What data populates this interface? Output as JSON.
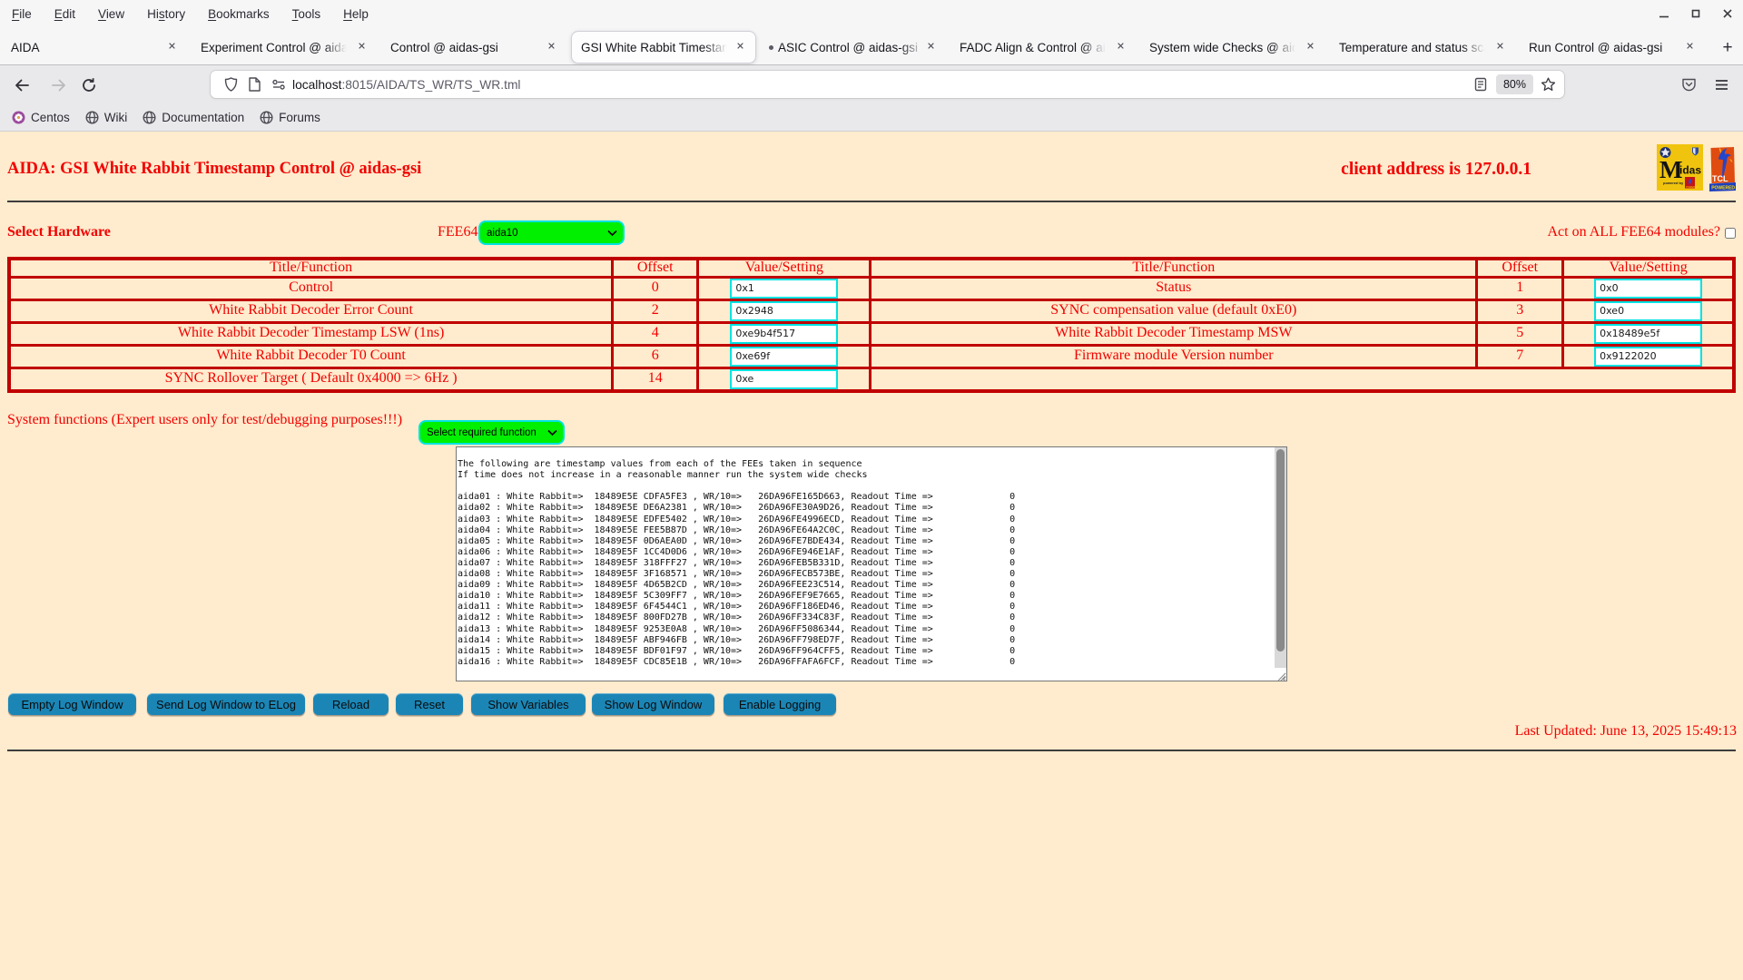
{
  "browser": {
    "menu": [
      {
        "pre": "",
        "u": "F",
        "post": "ile"
      },
      {
        "pre": "",
        "u": "E",
        "post": "dit"
      },
      {
        "pre": "",
        "u": "V",
        "post": "iew"
      },
      {
        "pre": "Hi",
        "u": "s",
        "post": "tory"
      },
      {
        "pre": "",
        "u": "B",
        "post": "ookmarks"
      },
      {
        "pre": "",
        "u": "T",
        "post": "ools"
      },
      {
        "pre": "",
        "u": "H",
        "post": "elp"
      }
    ],
    "window_controls": {
      "minimize": "minimize",
      "restore": "restore",
      "close": "close"
    },
    "tabs": [
      {
        "title": "AIDA"
      },
      {
        "title": "Experiment Control @ aidas-gsi"
      },
      {
        "title": "Control @ aidas-gsi"
      },
      {
        "title": "GSI White Rabbit Timestamp Control @ aidas-gsi",
        "active": true
      },
      {
        "title": "ASIC Control @ aidas-gsi",
        "attention_dot": true
      },
      {
        "title": "FADC Align & Control @ aidas-gsi"
      },
      {
        "title": "System wide Checks @ aidas-gsi"
      },
      {
        "title": "Temperature and status scans @ aidas-gsi"
      },
      {
        "title": "Run Control @ aidas-gsi"
      }
    ],
    "tab_close_glyph": "✕",
    "new_tab_label": "+",
    "url": {
      "host": "localhost",
      "path": ":8015/AIDA/TS_WR/TS_WR.tml"
    },
    "zoom_level": "80%",
    "bookmarks": [
      {
        "label": "Centos",
        "icon": "centos-icon"
      },
      {
        "label": "Wiki",
        "icon": "globe-icon"
      },
      {
        "label": "Documentation",
        "icon": "globe-icon"
      },
      {
        "label": "Forums",
        "icon": "globe-icon"
      }
    ]
  },
  "page": {
    "title": "AIDA: GSI White Rabbit Timestamp Control @ aidas-gsi",
    "client_address": "client address is 127.0.0.1",
    "logos": {
      "midas": "Midas logo",
      "tcl": "TCL powered logo"
    },
    "select_hardware_label": "Select Hardware",
    "fee64_label": "FEE64",
    "fee64_selected": "aida10",
    "act_on_all_label": "Act on ALL FEE64 modules?",
    "table": {
      "headers": {
        "title": "Title/Function",
        "offset": "Offset",
        "value": "Value/Setting"
      },
      "left_rows": [
        {
          "title": "Control",
          "offset": "0",
          "value": "0x1"
        },
        {
          "title": "White Rabbit Decoder Error Count",
          "offset": "2",
          "value": "0x2948"
        },
        {
          "title": "White Rabbit Decoder Timestamp LSW (1ns)",
          "offset": "4",
          "value": "0xe9b4f517"
        },
        {
          "title": "White Rabbit Decoder T0 Count",
          "offset": "6",
          "value": "0xe69f"
        },
        {
          "title": "SYNC Rollover Target ( Default 0x4000 => 6Hz )",
          "offset": "14",
          "value": "0xe"
        }
      ],
      "right_rows": [
        {
          "title": "Status",
          "offset": "1",
          "value": "0x0"
        },
        {
          "title": "SYNC compensation value (default 0xE0)",
          "offset": "3",
          "value": "0xe0"
        },
        {
          "title": "White Rabbit Decoder Timestamp MSW",
          "offset": "5",
          "value": "0x18489e5f"
        },
        {
          "title": "Firmware module Version number",
          "offset": "7",
          "value": "0x9122020"
        }
      ]
    },
    "system_functions_label": "System functions (Expert users only for test/debugging purposes!!!)",
    "system_functions_selected": "Select required function",
    "log": {
      "lines": [
        "",
        "The following are timestamp values from each of the FEEs taken in sequence",
        "If time does not increase in a reasonable manner run the system wide checks",
        "",
        "aida01 : White Rabbit=>  18489E5E CDFA5FE3 , WR/10=>   26DA96FE165D663, Readout Time =>              0",
        "aida02 : White Rabbit=>  18489E5E DE6A2381 , WR/10=>   26DA96FE30A9D26, Readout Time =>              0",
        "aida03 : White Rabbit=>  18489E5E EDFE5402 , WR/10=>   26DA96FE4996ECD, Readout Time =>              0",
        "aida04 : White Rabbit=>  18489E5E FEE5B87D , WR/10=>   26DA96FE64A2C0C, Readout Time =>              0",
        "aida05 : White Rabbit=>  18489E5F 0D6AEA0D , WR/10=>   26DA96FE7BDE434, Readout Time =>              0",
        "aida06 : White Rabbit=>  18489E5F 1CC4D0D6 , WR/10=>   26DA96FE946E1AF, Readout Time =>              0",
        "aida07 : White Rabbit=>  18489E5F 318FFF27 , WR/10=>   26DA96FEB5B331D, Readout Time =>              0",
        "aida08 : White Rabbit=>  18489E5F 3F168571 , WR/10=>   26DA96FECB573BE, Readout Time =>              0",
        "aida09 : White Rabbit=>  18489E5F 4D65B2CD , WR/10=>   26DA96FEE23C514, Readout Time =>              0",
        "aida10 : White Rabbit=>  18489E5F 5C309FF7 , WR/10=>   26DA96FEF9E7665, Readout Time =>              0",
        "aida11 : White Rabbit=>  18489E5F 6F4544C1 , WR/10=>   26DA96FF186ED46, Readout Time =>              0",
        "aida12 : White Rabbit=>  18489E5F 800FD27B , WR/10=>   26DA96FF334C83F, Readout Time =>              0",
        "aida13 : White Rabbit=>  18489E5F 9253E0A8 , WR/10=>   26DA96FF5086344, Readout Time =>              0",
        "aida14 : White Rabbit=>  18489E5F ABF946FB , WR/10=>   26DA96FF798ED7F, Readout Time =>              0",
        "aida15 : White Rabbit=>  18489E5F BDF01F97 , WR/10=>   26DA96FF964CFF5, Readout Time =>              0",
        "aida16 : White Rabbit=>  18489E5F CDC85E1B , WR/10=>   26DA96FFAFA6FCF, Readout Time =>              0",
        "",
        "",
        ""
      ]
    },
    "buttons": [
      "Empty Log Window",
      "Send Log Window to ELog",
      "Reload",
      "Reset",
      "Show Variables",
      "Show Log Window",
      "Enable Logging"
    ],
    "last_updated": "Last Updated: June 13, 2025 15:49:13"
  },
  "colors": {
    "page_background": "#ffebcd",
    "page_text_red": "#f20000",
    "table_border_red": "#c00000",
    "input_border_cyan": "#00e2e2",
    "select_green": "#00f000",
    "button_blue": "#1b86b6",
    "chrome_top": "#f6f6f7",
    "chrome_toolbar": "#e9e9eb"
  }
}
